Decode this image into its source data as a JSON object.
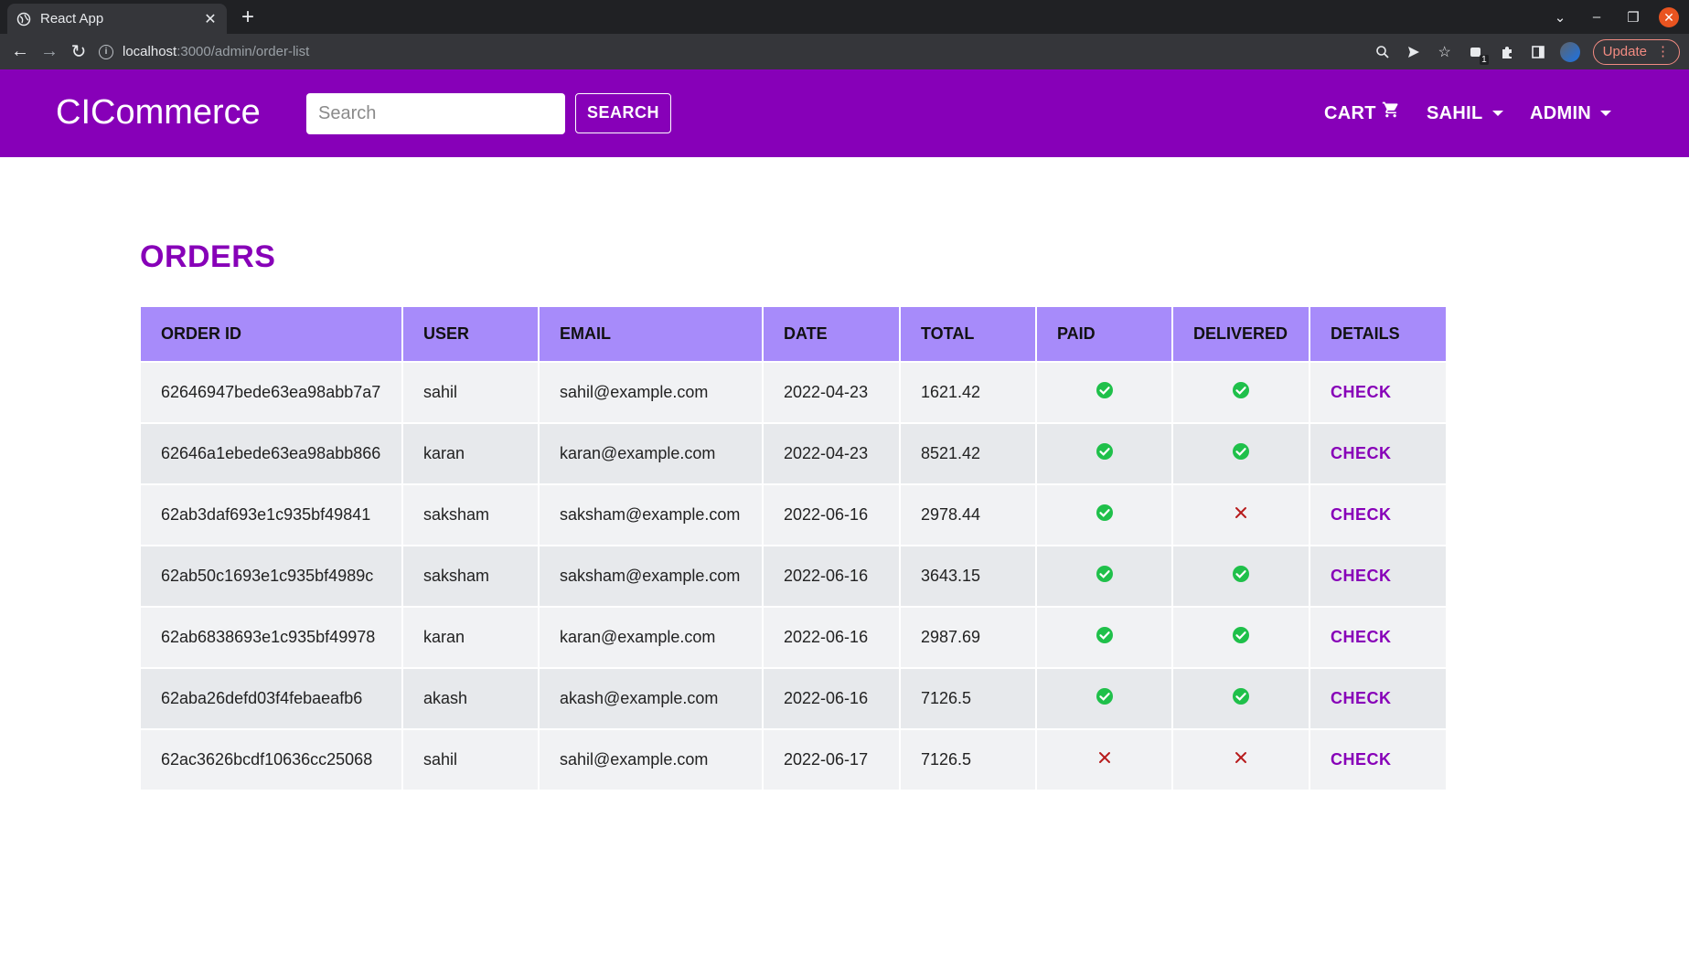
{
  "browser": {
    "tab_title": "React App",
    "url_host": "localhost",
    "url_path": ":3000/admin/order-list",
    "update_label": "Update",
    "extension_badge": "1"
  },
  "header": {
    "brand": "CICommerce",
    "search_placeholder": "Search",
    "search_button": "SEARCH",
    "cart_label": "CART",
    "user_label": "SAHIL",
    "admin_label": "ADMIN",
    "brand_color": "#8700b8"
  },
  "page": {
    "title": "ORDERS"
  },
  "table": {
    "columns": [
      "ORDER ID",
      "USER",
      "EMAIL",
      "DATE",
      "TOTAL",
      "PAID",
      "DELIVERED",
      "DETAILS"
    ],
    "rows": [
      {
        "id": "62646947bede63ea98abb7a7",
        "user": "sahil",
        "email": "sahil@example.com",
        "date": "2022-04-23",
        "total": "1621.42",
        "paid": true,
        "delivered": true,
        "details": "CHECK"
      },
      {
        "id": "62646a1ebede63ea98abb866",
        "user": "karan",
        "email": "karan@example.com",
        "date": "2022-04-23",
        "total": "8521.42",
        "paid": true,
        "delivered": true,
        "details": "CHECK"
      },
      {
        "id": "62ab3daf693e1c935bf49841",
        "user": "saksham",
        "email": "saksham@example.com",
        "date": "2022-06-16",
        "total": "2978.44",
        "paid": true,
        "delivered": false,
        "details": "CHECK"
      },
      {
        "id": "62ab50c1693e1c935bf4989c",
        "user": "saksham",
        "email": "saksham@example.com",
        "date": "2022-06-16",
        "total": "3643.15",
        "paid": true,
        "delivered": true,
        "details": "CHECK"
      },
      {
        "id": "62ab6838693e1c935bf49978",
        "user": "karan",
        "email": "karan@example.com",
        "date": "2022-06-16",
        "total": "2987.69",
        "paid": true,
        "delivered": true,
        "details": "CHECK"
      },
      {
        "id": "62aba26defd03f4febaeafb6",
        "user": "akash",
        "email": "akash@example.com",
        "date": "2022-06-16",
        "total": "7126.5",
        "paid": true,
        "delivered": true,
        "details": "CHECK"
      },
      {
        "id": "62ac3626bcdf10636cc25068",
        "user": "sahil",
        "email": "sahil@example.com",
        "date": "2022-06-17",
        "total": "7126.5",
        "paid": false,
        "delivered": false,
        "details": "CHECK"
      }
    ],
    "status_colors": {
      "yes": "#1fc04a",
      "no": "#b71c1c"
    },
    "status_icons": {
      "yes": "check-circle-icon",
      "no": "cross-icon"
    }
  }
}
